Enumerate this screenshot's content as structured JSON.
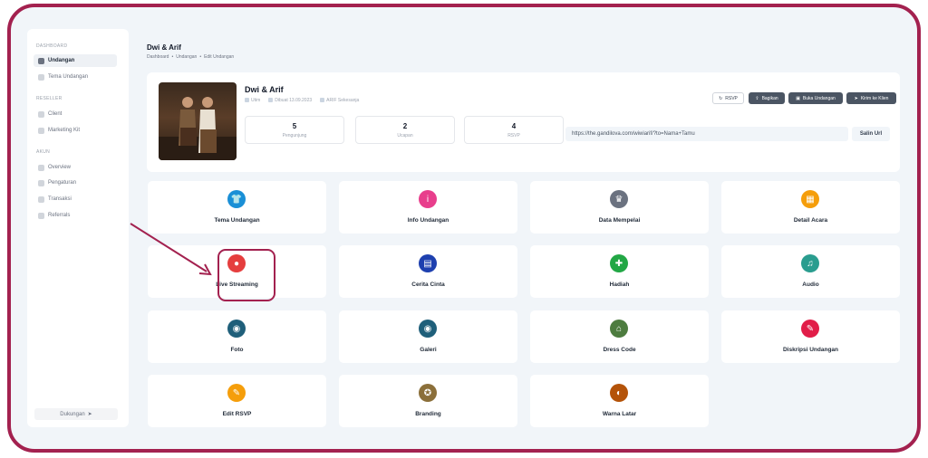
{
  "sidebar": {
    "sections": [
      {
        "label": "DASHBOARD",
        "items": [
          {
            "label": "Undangan",
            "active": true,
            "icon": "invitation-icon"
          },
          {
            "label": "Tema Undangan",
            "active": false,
            "icon": "theme-icon"
          }
        ]
      },
      {
        "label": "RESELLER",
        "items": [
          {
            "label": "Client",
            "active": false,
            "icon": "client-icon"
          },
          {
            "label": "Marketing Kit",
            "active": false,
            "icon": "marketing-icon"
          }
        ]
      },
      {
        "label": "AKUN",
        "items": [
          {
            "label": "Overview",
            "active": false,
            "icon": "overview-icon"
          },
          {
            "label": "Pengaturan",
            "active": false,
            "icon": "settings-icon"
          },
          {
            "label": "Transaksi",
            "active": false,
            "icon": "transaction-icon"
          },
          {
            "label": "Referrals",
            "active": false,
            "icon": "referral-icon"
          }
        ]
      }
    ],
    "footer": "Dukungan"
  },
  "page": {
    "title": "Dwi & Arif",
    "breadcrumb": [
      "Dashboard",
      "•",
      "Undangan",
      "•",
      "Edit Undangan"
    ]
  },
  "header": {
    "title": "Dwi & Arif",
    "meta": [
      "Utim",
      "Dibuat 13.09.2023",
      "ARIF Sekesanja"
    ],
    "stats": [
      {
        "value": "5",
        "label": "Pengunjung"
      },
      {
        "value": "2",
        "label": "Ucapan"
      },
      {
        "value": "4",
        "label": "RSVP"
      }
    ],
    "url": "https://the.gandilova.com/wiwiarif/?to=Nama+Tamu",
    "copy_label": "Salin Url",
    "actions": [
      {
        "label": "RSVP",
        "style": "light"
      },
      {
        "label": "Bagikan",
        "style": "dark"
      },
      {
        "label": "Buka Undangan",
        "style": "dark"
      },
      {
        "label": "Kirim ke Klien",
        "style": "dark"
      }
    ]
  },
  "tiles": [
    {
      "label": "Tema Undangan",
      "icon": "shirt-icon",
      "color": "#1a8fd6",
      "glyph": "👕"
    },
    {
      "label": "Info Undangan",
      "icon": "info-icon",
      "color": "#e83e8c",
      "glyph": "i"
    },
    {
      "label": "Data Mempelai",
      "icon": "couple-icon",
      "color": "#6b7280",
      "glyph": "♛"
    },
    {
      "label": "Detail Acara",
      "icon": "calendar-icon",
      "color": "#f59e0b",
      "glyph": "▦"
    },
    {
      "label": "Live Streaming",
      "icon": "live-icon",
      "color": "#e53e3e",
      "glyph": "●"
    },
    {
      "label": "Cerita Cinta",
      "icon": "book-icon",
      "color": "#1e40af",
      "glyph": "▤"
    },
    {
      "label": "Hadiah",
      "icon": "gift-icon",
      "color": "#22a745",
      "glyph": "✚"
    },
    {
      "label": "Audio",
      "icon": "headphones-icon",
      "color": "#2a9d8f",
      "glyph": "♫"
    },
    {
      "label": "Foto",
      "icon": "camera-icon",
      "color": "#1f5f7a",
      "glyph": "◉"
    },
    {
      "label": "Galeri",
      "icon": "gallery-icon",
      "color": "#1f5f7a",
      "glyph": "◉"
    },
    {
      "label": "Dress Code",
      "icon": "hanger-icon",
      "color": "#4d7c3f",
      "glyph": "⌂"
    },
    {
      "label": "Diskripsi Undangan",
      "icon": "document-icon",
      "color": "#e11d48",
      "glyph": "✎"
    },
    {
      "label": "Edit RSVP",
      "icon": "edit-icon",
      "color": "#f59e0b",
      "glyph": "✎"
    },
    {
      "label": "Branding",
      "icon": "badge-icon",
      "color": "#8b6f3a",
      "glyph": "✪"
    },
    {
      "label": "Warna Latar",
      "icon": "palette-icon",
      "color": "#b45309",
      "glyph": "◐"
    }
  ]
}
